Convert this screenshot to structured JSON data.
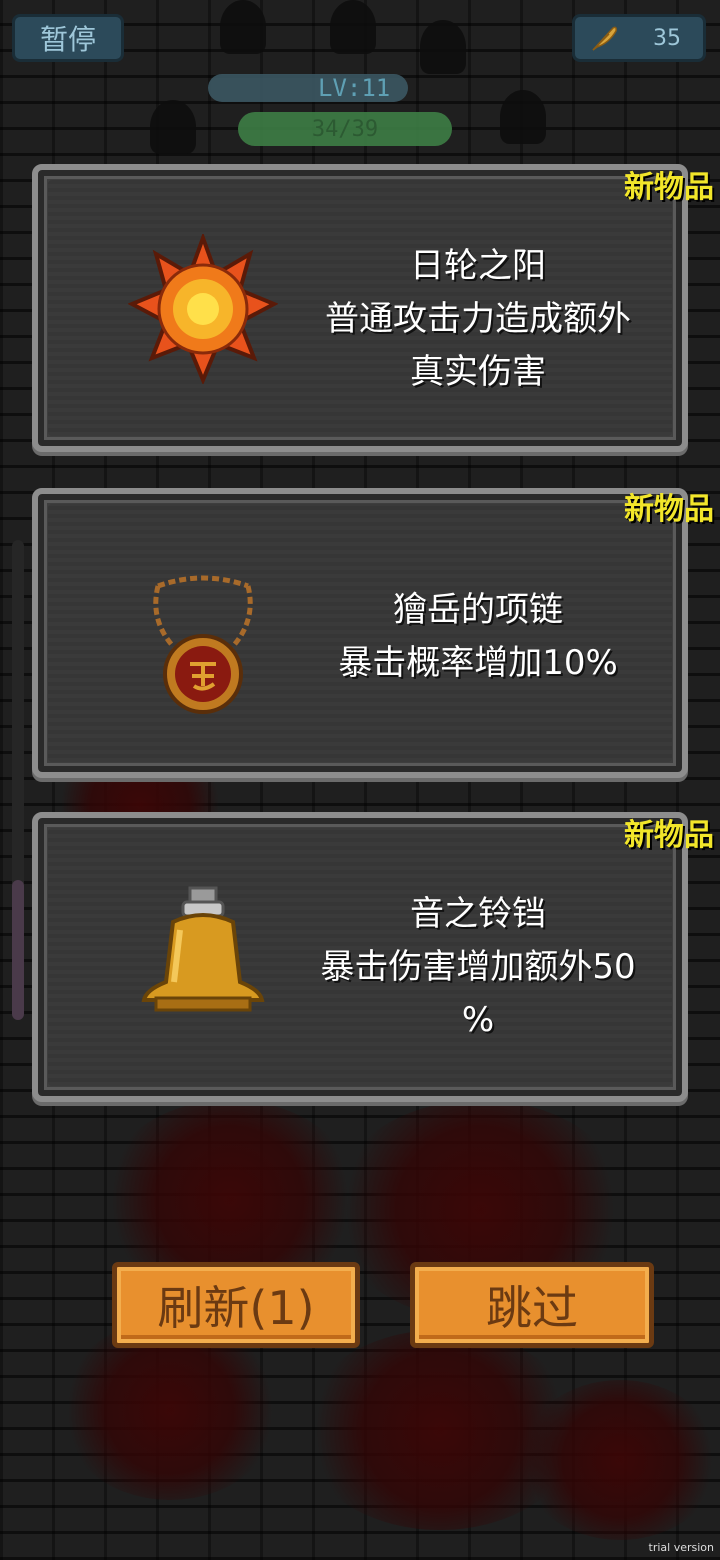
{
  "hud": {
    "pause_label": "暂停",
    "currency_icon": "feather-icon",
    "currency_value": "35",
    "level_label": "LV:11",
    "hp_text": "34/39"
  },
  "offers": [
    {
      "tag": "新物品",
      "icon": "sun-wheel-icon",
      "lines": [
        "日轮之阳",
        "普通攻击力造成额外",
        "真实伤害"
      ]
    },
    {
      "tag": "新物品",
      "icon": "necklace-icon",
      "lines": [
        "獪岳的项链",
        "暴击概率增加10%"
      ]
    },
    {
      "tag": "新物品",
      "icon": "bell-icon",
      "lines": [
        "音之铃铛",
        "暴击伤害增加额外50",
        "%"
      ]
    }
  ],
  "buttons": {
    "refresh_label": "刷新(1)",
    "skip_label": "跳过"
  },
  "watermark": "trial version",
  "colors": {
    "tag": "#f2e62a",
    "button": "#e8902e",
    "panel": "#3e3e3e"
  }
}
